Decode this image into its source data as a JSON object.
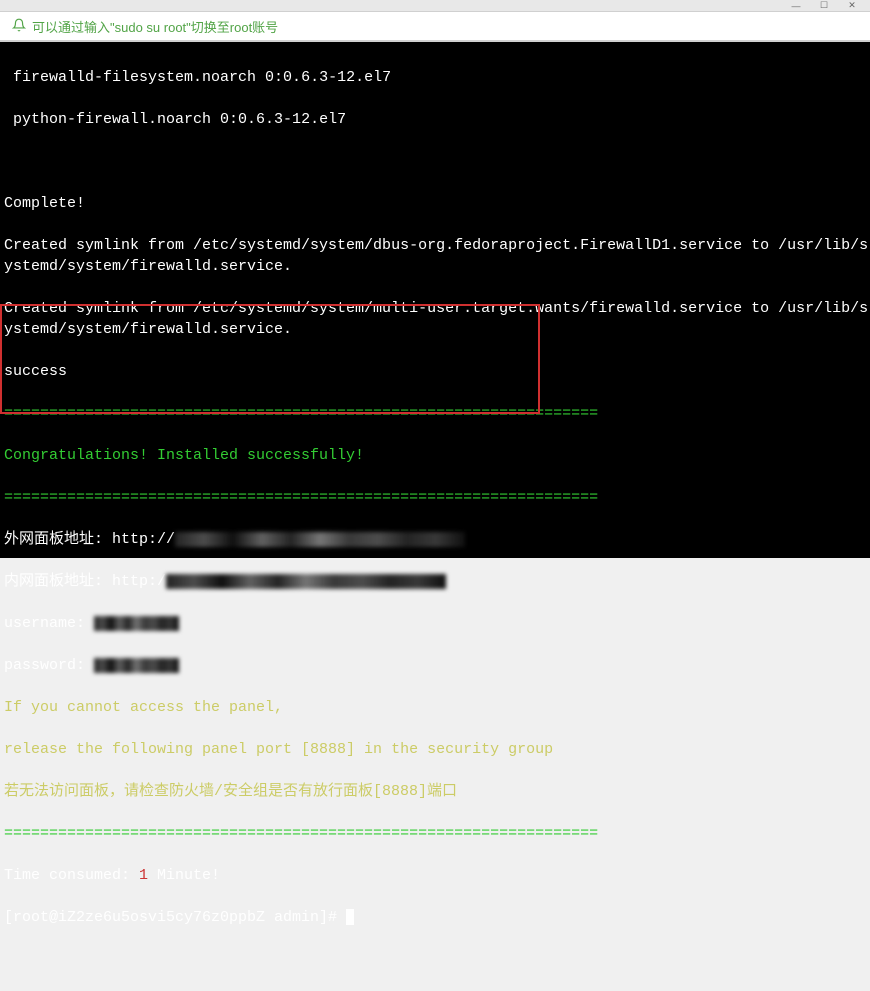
{
  "titlebar": {
    "minimize": "—",
    "maximize": "☐",
    "close": "✕"
  },
  "notice": {
    "text": "可以通过输入\"sudo su root\"切换至root账号"
  },
  "terminal": {
    "pkg1": " firewalld-filesystem.noarch 0:0.6.3-12.el7",
    "pkg2": " python-firewall.noarch 0:0.6.3-12.el7",
    "complete": "Complete!",
    "symlink1": "Created symlink from /etc/systemd/system/dbus-org.fedoraproject.FirewallD1.service to /usr/lib/systemd/system/firewalld.service.",
    "symlink2": "Created symlink from /etc/systemd/system/multi-user.target.wants/firewalld.service to /usr/lib/systemd/system/firewalld.service.",
    "success": "success",
    "separator": "==================================================================",
    "congrats": "Congratulations! Installed successfully!",
    "addr_ext_label": "外网面板地址: http://",
    "addr_int_label": "内网面板地址: http:/",
    "username_label": "username: ",
    "password_label": "password: ",
    "warn1": "If you cannot access the panel,",
    "warn2": "release the following panel port [8888] in the security group",
    "warn3": "若无法访问面板，请检查防火墙/安全组是否有放行面板[8888]端口",
    "time_label": "Time consumed: ",
    "time_value": "1",
    "time_unit": " Minute!",
    "prompt_user": "[root@iZ2ze6u5osvi5cy76z0ppbZ admin]# "
  }
}
